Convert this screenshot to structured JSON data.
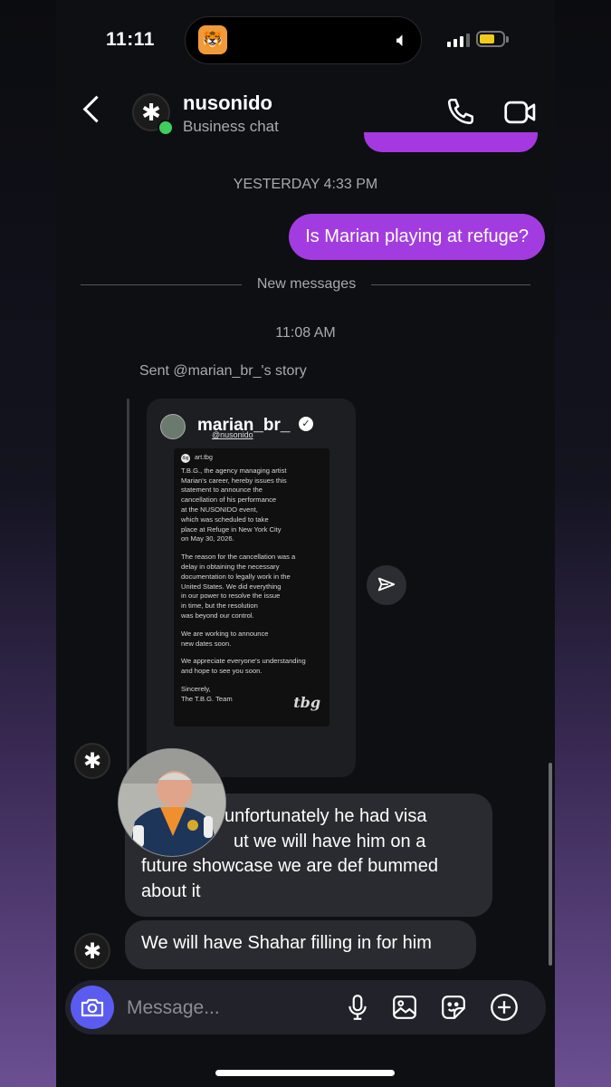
{
  "status_bar": {
    "time": "11:11"
  },
  "header": {
    "name": "nusonido",
    "subtitle": "Business chat"
  },
  "thread": {
    "timestamp_1": "YESTERDAY 4:33 PM",
    "outgoing_1": "Is Marian playing at refuge?",
    "new_messages_label": "New messages",
    "timestamp_2": "11:08 AM",
    "story_label": "Sent @marian_br_'s story",
    "story": {
      "username": "marian_br_",
      "mention": "@nusonido",
      "notice_account": "art.tbg",
      "notice_badge": "tbg",
      "notice_paragraphs": [
        "T.B.G., the agency managing artist\nMarian's career, hereby issues this\nstatement to announce the\ncancellation of his performance\nat the NUSONIDO event,\nwhich was scheduled to take\nplace at Refuge in New York City\non May 30, 2026.",
        "The reason for the cancellation was a\ndelay in obtaining the necessary\ndocumentation to legally work in the\nUnited States. We did everything\nin our power to resolve the issue\nin time, but the resolution\nwas beyond our control.",
        "We are working to announce\nnew dates soon.",
        "We appreciate everyone's understanding\nand hope to see you soon.",
        "Sincerely,\nThe T.B.G. Team"
      ],
      "notice_logo": "tbg"
    },
    "incoming_1": "unfortunately he had visa ... but we will have him on a future showcase we are def bummed about it",
    "incoming_1_lines": [
      "unfortunately he had visa",
      "ut we will have him on a",
      "future showcase we are def bummed",
      "about it"
    ],
    "incoming_2": "We will have Shahar filling in for him"
  },
  "composer": {
    "placeholder": "Message..."
  },
  "icons": {
    "back": "chevron-left-icon",
    "call": "phone-icon",
    "video": "video-camera-icon",
    "share": "send-icon",
    "camera": "camera-icon",
    "mic": "microphone-icon",
    "gallery": "image-icon",
    "sticker": "sticker-icon",
    "plus": "plus-icon"
  },
  "colors": {
    "outgoing_bubble": "#a23ce0",
    "incoming_bubble": "#2a2b30",
    "online": "#3dd05c",
    "camera_button": "#5a5bf0",
    "battery": "#f2cc1c"
  }
}
